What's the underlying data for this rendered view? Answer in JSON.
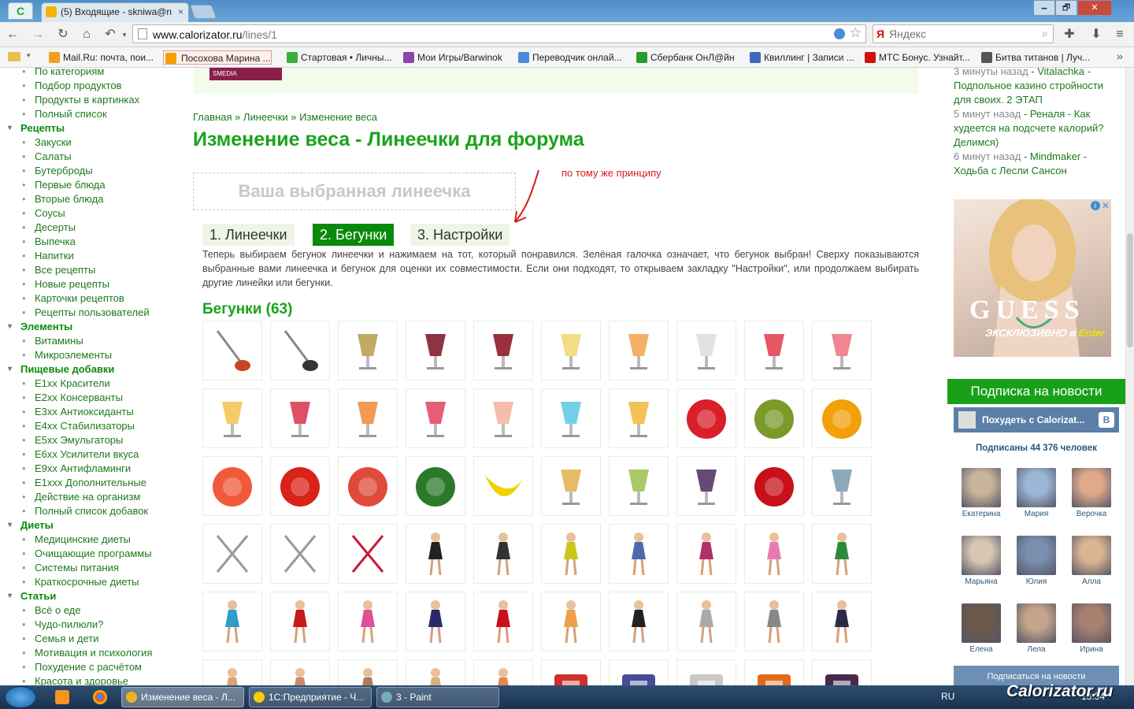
{
  "browser": {
    "tabs": [
      {
        "label": "C",
        "active": true
      },
      {
        "label": "(5) Входящие - skniwa@n",
        "close": "×"
      }
    ],
    "window_buttons": [
      "🗕",
      "🗗",
      "✕"
    ],
    "url_host": "www.calorizator.ru",
    "url_path": "/lines/1",
    "search_placeholder": "Яндекс",
    "bookmarks": [
      {
        "label": "Mail.Ru: почта, пои...",
        "color": "#f0a020"
      },
      {
        "label": "Посохова Марина ...",
        "color": "#f4a000",
        "active": true
      },
      {
        "label": "Стартовая • Личны...",
        "color": "#3ab03a"
      },
      {
        "label": "Мои Игры/Barwinok",
        "color": "#8844aa"
      },
      {
        "label": "Переводчик онлай...",
        "color": "#4a8ad8"
      },
      {
        "label": "Сбербанк ОнЛ@йн",
        "color": "#2a9a2a"
      },
      {
        "label": "Квиллинг | Записи ...",
        "color": "#3a6ab8"
      },
      {
        "label": "МТС Бонус. Узнайт...",
        "color": "#d01010"
      },
      {
        "label": "Битва титанов | Луч...",
        "color": "#555555"
      }
    ],
    "bookmarks_overflow": "»"
  },
  "sidebar": {
    "lines": [
      {
        "type": "item",
        "label": "По категориям"
      },
      {
        "type": "item",
        "label": "Подбор продуктов"
      },
      {
        "type": "item",
        "label": "Продукты в картинках"
      },
      {
        "type": "item",
        "label": "Полный список"
      },
      {
        "type": "cat",
        "label": "Рецепты"
      },
      {
        "type": "item",
        "label": "Закуски"
      },
      {
        "type": "item",
        "label": "Салаты"
      },
      {
        "type": "item",
        "label": "Бутерброды"
      },
      {
        "type": "item",
        "label": "Первые блюда"
      },
      {
        "type": "item",
        "label": "Вторые блюда"
      },
      {
        "type": "item",
        "label": "Соусы"
      },
      {
        "type": "item",
        "label": "Десерты"
      },
      {
        "type": "item",
        "label": "Выпечка"
      },
      {
        "type": "item",
        "label": "Напитки"
      },
      {
        "type": "item",
        "label": "Все рецепты"
      },
      {
        "type": "item",
        "label": "Новые рецепты"
      },
      {
        "type": "item",
        "label": "Карточки рецептов"
      },
      {
        "type": "item",
        "label": "Рецепты пользователей"
      },
      {
        "type": "cat",
        "label": "Элементы"
      },
      {
        "type": "item",
        "label": "Витамины"
      },
      {
        "type": "item",
        "label": "Микроэлементы"
      },
      {
        "type": "cat",
        "label": "Пищевые добавки"
      },
      {
        "type": "item",
        "label": "E1xx Красители"
      },
      {
        "type": "item",
        "label": "E2xx Консерванты"
      },
      {
        "type": "item",
        "label": "E3xx Антиоксиданты"
      },
      {
        "type": "item",
        "label": "E4xx Стабилизаторы"
      },
      {
        "type": "item",
        "label": "E5xx Эмульгаторы"
      },
      {
        "type": "item",
        "label": "E6xx Усилители вкуса"
      },
      {
        "type": "item",
        "label": "E9xx Антифламинги"
      },
      {
        "type": "item",
        "label": "E1xxx Дополнительные"
      },
      {
        "type": "item",
        "label": "Действие на организм"
      },
      {
        "type": "item",
        "label": "Полный список добавок"
      },
      {
        "type": "cat",
        "label": "Диеты"
      },
      {
        "type": "item",
        "label": "Медицинские диеты"
      },
      {
        "type": "item",
        "label": "Очищающие программы"
      },
      {
        "type": "item",
        "label": "Системы питания"
      },
      {
        "type": "item",
        "label": "Краткосрочные диеты"
      },
      {
        "type": "cat",
        "label": "Статьи"
      },
      {
        "type": "item",
        "label": "Всё о еде"
      },
      {
        "type": "item",
        "label": "Чудо-пилюли?"
      },
      {
        "type": "item",
        "label": "Семья и дети"
      },
      {
        "type": "item",
        "label": "Мотивация и психология"
      },
      {
        "type": "item",
        "label": "Похудение с расчётом"
      },
      {
        "type": "item",
        "label": "Красота и здоровье"
      }
    ]
  },
  "main": {
    "banner_logo": "SMEDIA",
    "breadcrumb": "Главная » Линеечки » Изменение веса",
    "title": "Изменение веса - Линеечки для форума",
    "selected_placeholder": "Ваша выбранная линеечка",
    "annotation": "по тому же принципу",
    "steps": [
      {
        "label": "1. Линеечки",
        "active": false
      },
      {
        "label": "2. Бегунки",
        "active": true
      },
      {
        "label": "3. Настройки",
        "active": false
      }
    ],
    "intro": "Теперь выбираем бегунок линеечки и нажимаем на тот, который понравился. Зелёная галочка означает, что бегунок выбран! Сверху показываются выбранные вами линеечка и бегунок для оценки их совместимости. Если они подходят, то открываем закладку \"Настройки\", или продолжаем выбирать другие линейки или бегунки.",
    "runners_title": "Бегунки (63)",
    "runners": [
      "caviar-spoon-red",
      "caviar-spoon-black",
      "champagne-bucket",
      "wine-bottle",
      "red-wine-glass",
      "champagne-flute",
      "cocktail-orange",
      "martini-olive",
      "cosmopolitan",
      "frozen-cocktail",
      "layered-cocktail",
      "punch-glass",
      "orange-juice",
      "berry-drink",
      "pink-lemonade",
      "blue-martini",
      "beer-mug",
      "strawberry",
      "kiwi",
      "orange",
      "grapefruit",
      "apple",
      "watermelon-slice",
      "watermelon",
      "banana",
      "pineapple-slice",
      "green-grapes",
      "dark-grapes",
      "cherry",
      "plate",
      "fork-knife",
      "fork-spoon",
      "rose",
      "girl-1",
      "girl-2",
      "girl-3",
      "girl-4",
      "girl-5",
      "girl-6",
      "girl-7",
      "girl-8",
      "girl-9",
      "girl-10",
      "girl-11",
      "girl-12",
      "girl-13",
      "girl-14",
      "elliptical",
      "exercise-bike",
      "yoga",
      "dancer-1",
      "dancer-2",
      "dancer-3",
      "dancer-4",
      "dancer-5",
      "red-scale",
      "blue-scale",
      "silver-scale",
      "footprints",
      "footprints-dark"
    ]
  },
  "right": {
    "feed": [
      {
        "time": "3 минуты назад",
        "text": " - Vitalachka - Подпольное казино стройности для своих. 2 ЭТАП"
      },
      {
        "time": "5 минут назад",
        "text": " - Реналя - Как худеется на подсчете калорий? Делимся)"
      },
      {
        "time": "6 минут назад",
        "text": " - Mindmaker - Ходьба с Лесли Сансон"
      }
    ],
    "ad": {
      "brand": "GUESS",
      "line1": "ЭКСКЛЮЗИВНО",
      "line2": "в",
      "line3": "Enter",
      "info": "i",
      "close": "✕"
    },
    "subscribe_label": "Подписка на новости",
    "vk_group": "Похудеть с Calorizat...",
    "vk_logo": "B",
    "vk_count": "Подписаны 44 376 человек",
    "friends": [
      "Екатерина",
      "Мария",
      "Верочка",
      "Марьяна",
      "Юлия",
      "Алла",
      "Елена",
      "Лела",
      "Ирина"
    ],
    "vk_subscribe": "Подписаться на новости"
  },
  "taskbar": {
    "tasks": [
      {
        "label": "Изменение веса - Л...",
        "active": true
      },
      {
        "label": "1С:Предприятие - Ч...",
        "active": false
      },
      {
        "label": "3 - Paint",
        "active": false
      }
    ],
    "lang": "RU",
    "time": "13:34",
    "watermark": "Calorizator.ru"
  },
  "colors": {
    "brand_green": "#1aa31a",
    "link_green": "#1d7a1d",
    "step_active": "#0a8a0a",
    "annotation_red": "#d41c1c"
  }
}
